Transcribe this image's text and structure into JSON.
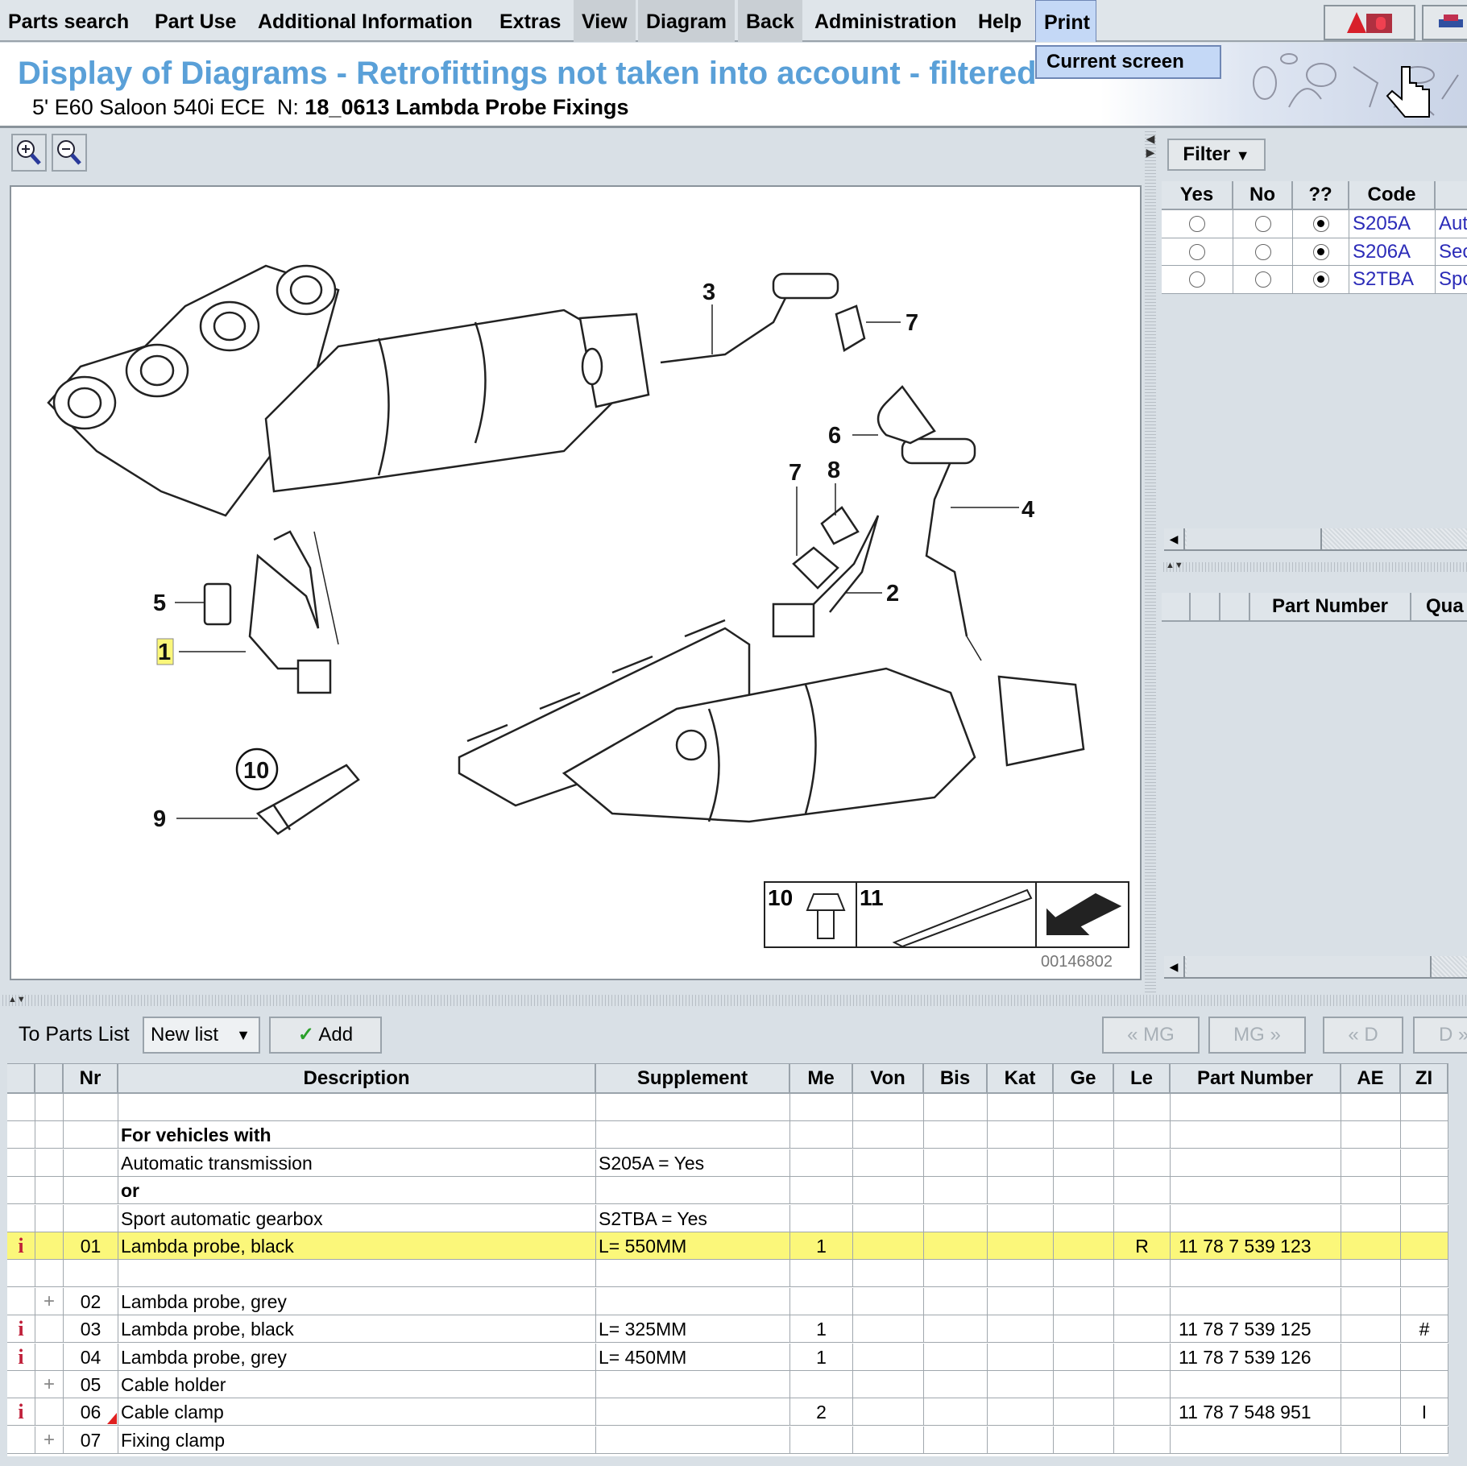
{
  "menu": {
    "items": [
      "Parts search",
      "Part Use",
      "Additional Information",
      "Extras",
      "View",
      "Diagram",
      "Back",
      "Administration",
      "Help",
      "Print"
    ],
    "print_dropdown": [
      "Current screen"
    ]
  },
  "header": {
    "title": "Display of Diagrams - Retrofittings not taken into account - filtered",
    "vehicle": "5' E60 Saloon 540i ECE",
    "node_prefix": "N:",
    "node": "18_0613 Lambda Probe Fixings"
  },
  "diagram_toolbar": {
    "zoom_in": "zoom-in-icon",
    "zoom_out": "zoom-out-icon"
  },
  "diagram": {
    "callouts": [
      "3",
      "7",
      "6",
      "7",
      "8",
      "4",
      "2",
      "5",
      "1",
      "10",
      "9"
    ],
    "legend": [
      "10",
      "11"
    ],
    "image_number": "00146802",
    "highlight_color": "#fbf77a"
  },
  "filter": {
    "button": "Filter",
    "columns": [
      "Yes",
      "No",
      "??",
      "Code",
      ""
    ],
    "rows": [
      {
        "code": "S205A",
        "desc": "Aut",
        "selected": "??"
      },
      {
        "code": "S206A",
        "desc": "Sec",
        "selected": "??"
      },
      {
        "code": "S2TBA",
        "desc": "Spo",
        "selected": "??"
      }
    ]
  },
  "selection_list": {
    "columns": [
      "",
      "",
      "",
      "Part Number",
      "Qua"
    ]
  },
  "parts_toolbar": {
    "to_parts_list": "To Parts List",
    "list_select": "New list",
    "add": "Add",
    "nav": [
      "« MG",
      "MG »",
      "« D",
      "D »"
    ]
  },
  "parts_table": {
    "columns": [
      "",
      "",
      "Nr",
      "Description",
      "Supplement",
      "Me",
      "Von",
      "Bis",
      "Kat",
      "Ge",
      "Le",
      "Part Number",
      "AE",
      "ZI"
    ],
    "rows": [
      {
        "icon": "",
        "nr": "",
        "desc": "",
        "supp": "",
        "me": "",
        "le": "",
        "pn": "",
        "zi": ""
      },
      {
        "icon": "",
        "nr": "",
        "desc": "For vehicles with",
        "bold": true,
        "supp": "",
        "me": "",
        "le": "",
        "pn": "",
        "zi": ""
      },
      {
        "icon": "",
        "nr": "",
        "desc": "Automatic transmission",
        "supp": "S205A = Yes",
        "me": "",
        "le": "",
        "pn": "",
        "zi": ""
      },
      {
        "icon": "",
        "nr": "",
        "desc": "or",
        "bold": true,
        "supp": "",
        "me": "",
        "le": "",
        "pn": "",
        "zi": ""
      },
      {
        "icon": "",
        "nr": "",
        "desc": "Sport automatic gearbox",
        "supp": "S2TBA = Yes",
        "me": "",
        "le": "",
        "pn": "",
        "zi": ""
      },
      {
        "icon": "info",
        "nr": "01",
        "desc": "Lambda probe, black",
        "supp": "L= 550MM",
        "me": "1",
        "le": "R",
        "pn": "11 78 7 539 123",
        "zi": "",
        "highlight": true
      },
      {
        "icon": "",
        "nr": "",
        "desc": "",
        "supp": "",
        "me": "",
        "le": "",
        "pn": "",
        "zi": ""
      },
      {
        "icon": "plus",
        "nr": "02",
        "desc": "Lambda probe, grey",
        "supp": "",
        "me": "",
        "le": "",
        "pn": "",
        "zi": ""
      },
      {
        "icon": "info",
        "nr": "03",
        "desc": "Lambda probe, black",
        "supp": "L= 325MM",
        "me": "1",
        "le": "",
        "pn": "11 78 7 539 125",
        "zi": "#"
      },
      {
        "icon": "info",
        "nr": "04",
        "desc": "Lambda probe, grey",
        "supp": "L= 450MM",
        "me": "1",
        "le": "",
        "pn": "11 78 7 539 126",
        "zi": ""
      },
      {
        "icon": "plus",
        "nr": "05",
        "desc": "Cable holder",
        "supp": "",
        "me": "",
        "le": "",
        "pn": "",
        "zi": ""
      },
      {
        "icon": "info",
        "nr": "06",
        "desc": "Cable clamp",
        "supp": "",
        "me": "2",
        "le": "",
        "pn": "11 78 7 548 951",
        "zi": "I",
        "marker": true
      },
      {
        "icon": "plus",
        "nr": "07",
        "desc": "Fixing clamp",
        "supp": "",
        "me": "",
        "le": "",
        "pn": "",
        "zi": ""
      }
    ]
  },
  "colors": {
    "title": "#5aa0d8",
    "code_link": "#2b2bb8",
    "info_icon": "#c0203a",
    "row_highlight": "#fbf77a",
    "menu_selected": "#c4d8f6"
  }
}
